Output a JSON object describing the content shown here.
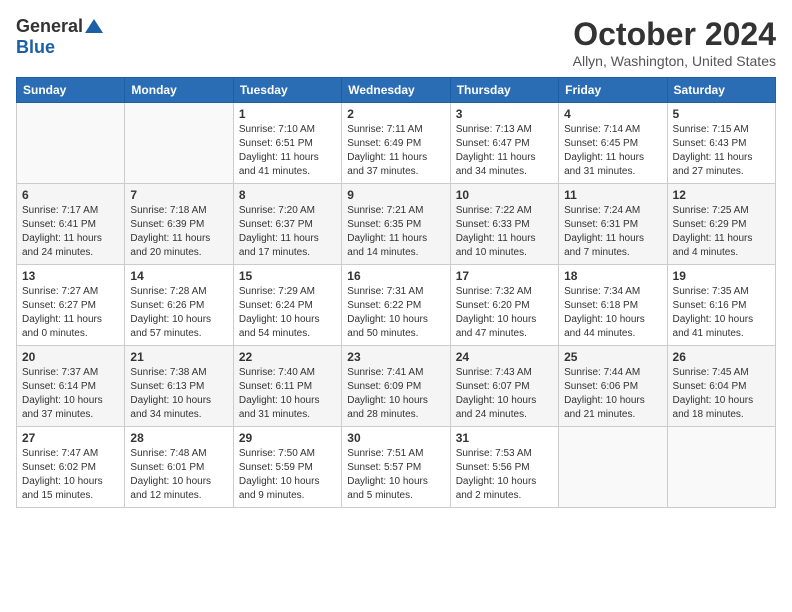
{
  "logo": {
    "general": "General",
    "blue": "Blue"
  },
  "title": "October 2024",
  "location": "Allyn, Washington, United States",
  "weekdays": [
    "Sunday",
    "Monday",
    "Tuesday",
    "Wednesday",
    "Thursday",
    "Friday",
    "Saturday"
  ],
  "weeks": [
    [
      {
        "day": "",
        "sunrise": "",
        "sunset": "",
        "daylight": ""
      },
      {
        "day": "",
        "sunrise": "",
        "sunset": "",
        "daylight": ""
      },
      {
        "day": "1",
        "sunrise": "Sunrise: 7:10 AM",
        "sunset": "Sunset: 6:51 PM",
        "daylight": "Daylight: 11 hours and 41 minutes."
      },
      {
        "day": "2",
        "sunrise": "Sunrise: 7:11 AM",
        "sunset": "Sunset: 6:49 PM",
        "daylight": "Daylight: 11 hours and 37 minutes."
      },
      {
        "day": "3",
        "sunrise": "Sunrise: 7:13 AM",
        "sunset": "Sunset: 6:47 PM",
        "daylight": "Daylight: 11 hours and 34 minutes."
      },
      {
        "day": "4",
        "sunrise": "Sunrise: 7:14 AM",
        "sunset": "Sunset: 6:45 PM",
        "daylight": "Daylight: 11 hours and 31 minutes."
      },
      {
        "day": "5",
        "sunrise": "Sunrise: 7:15 AM",
        "sunset": "Sunset: 6:43 PM",
        "daylight": "Daylight: 11 hours and 27 minutes."
      }
    ],
    [
      {
        "day": "6",
        "sunrise": "Sunrise: 7:17 AM",
        "sunset": "Sunset: 6:41 PM",
        "daylight": "Daylight: 11 hours and 24 minutes."
      },
      {
        "day": "7",
        "sunrise": "Sunrise: 7:18 AM",
        "sunset": "Sunset: 6:39 PM",
        "daylight": "Daylight: 11 hours and 20 minutes."
      },
      {
        "day": "8",
        "sunrise": "Sunrise: 7:20 AM",
        "sunset": "Sunset: 6:37 PM",
        "daylight": "Daylight: 11 hours and 17 minutes."
      },
      {
        "day": "9",
        "sunrise": "Sunrise: 7:21 AM",
        "sunset": "Sunset: 6:35 PM",
        "daylight": "Daylight: 11 hours and 14 minutes."
      },
      {
        "day": "10",
        "sunrise": "Sunrise: 7:22 AM",
        "sunset": "Sunset: 6:33 PM",
        "daylight": "Daylight: 11 hours and 10 minutes."
      },
      {
        "day": "11",
        "sunrise": "Sunrise: 7:24 AM",
        "sunset": "Sunset: 6:31 PM",
        "daylight": "Daylight: 11 hours and 7 minutes."
      },
      {
        "day": "12",
        "sunrise": "Sunrise: 7:25 AM",
        "sunset": "Sunset: 6:29 PM",
        "daylight": "Daylight: 11 hours and 4 minutes."
      }
    ],
    [
      {
        "day": "13",
        "sunrise": "Sunrise: 7:27 AM",
        "sunset": "Sunset: 6:27 PM",
        "daylight": "Daylight: 11 hours and 0 minutes."
      },
      {
        "day": "14",
        "sunrise": "Sunrise: 7:28 AM",
        "sunset": "Sunset: 6:26 PM",
        "daylight": "Daylight: 10 hours and 57 minutes."
      },
      {
        "day": "15",
        "sunrise": "Sunrise: 7:29 AM",
        "sunset": "Sunset: 6:24 PM",
        "daylight": "Daylight: 10 hours and 54 minutes."
      },
      {
        "day": "16",
        "sunrise": "Sunrise: 7:31 AM",
        "sunset": "Sunset: 6:22 PM",
        "daylight": "Daylight: 10 hours and 50 minutes."
      },
      {
        "day": "17",
        "sunrise": "Sunrise: 7:32 AM",
        "sunset": "Sunset: 6:20 PM",
        "daylight": "Daylight: 10 hours and 47 minutes."
      },
      {
        "day": "18",
        "sunrise": "Sunrise: 7:34 AM",
        "sunset": "Sunset: 6:18 PM",
        "daylight": "Daylight: 10 hours and 44 minutes."
      },
      {
        "day": "19",
        "sunrise": "Sunrise: 7:35 AM",
        "sunset": "Sunset: 6:16 PM",
        "daylight": "Daylight: 10 hours and 41 minutes."
      }
    ],
    [
      {
        "day": "20",
        "sunrise": "Sunrise: 7:37 AM",
        "sunset": "Sunset: 6:14 PM",
        "daylight": "Daylight: 10 hours and 37 minutes."
      },
      {
        "day": "21",
        "sunrise": "Sunrise: 7:38 AM",
        "sunset": "Sunset: 6:13 PM",
        "daylight": "Daylight: 10 hours and 34 minutes."
      },
      {
        "day": "22",
        "sunrise": "Sunrise: 7:40 AM",
        "sunset": "Sunset: 6:11 PM",
        "daylight": "Daylight: 10 hours and 31 minutes."
      },
      {
        "day": "23",
        "sunrise": "Sunrise: 7:41 AM",
        "sunset": "Sunset: 6:09 PM",
        "daylight": "Daylight: 10 hours and 28 minutes."
      },
      {
        "day": "24",
        "sunrise": "Sunrise: 7:43 AM",
        "sunset": "Sunset: 6:07 PM",
        "daylight": "Daylight: 10 hours and 24 minutes."
      },
      {
        "day": "25",
        "sunrise": "Sunrise: 7:44 AM",
        "sunset": "Sunset: 6:06 PM",
        "daylight": "Daylight: 10 hours and 21 minutes."
      },
      {
        "day": "26",
        "sunrise": "Sunrise: 7:45 AM",
        "sunset": "Sunset: 6:04 PM",
        "daylight": "Daylight: 10 hours and 18 minutes."
      }
    ],
    [
      {
        "day": "27",
        "sunrise": "Sunrise: 7:47 AM",
        "sunset": "Sunset: 6:02 PM",
        "daylight": "Daylight: 10 hours and 15 minutes."
      },
      {
        "day": "28",
        "sunrise": "Sunrise: 7:48 AM",
        "sunset": "Sunset: 6:01 PM",
        "daylight": "Daylight: 10 hours and 12 minutes."
      },
      {
        "day": "29",
        "sunrise": "Sunrise: 7:50 AM",
        "sunset": "Sunset: 5:59 PM",
        "daylight": "Daylight: 10 hours and 9 minutes."
      },
      {
        "day": "30",
        "sunrise": "Sunrise: 7:51 AM",
        "sunset": "Sunset: 5:57 PM",
        "daylight": "Daylight: 10 hours and 5 minutes."
      },
      {
        "day": "31",
        "sunrise": "Sunrise: 7:53 AM",
        "sunset": "Sunset: 5:56 PM",
        "daylight": "Daylight: 10 hours and 2 minutes."
      },
      {
        "day": "",
        "sunrise": "",
        "sunset": "",
        "daylight": ""
      },
      {
        "day": "",
        "sunrise": "",
        "sunset": "",
        "daylight": ""
      }
    ]
  ]
}
